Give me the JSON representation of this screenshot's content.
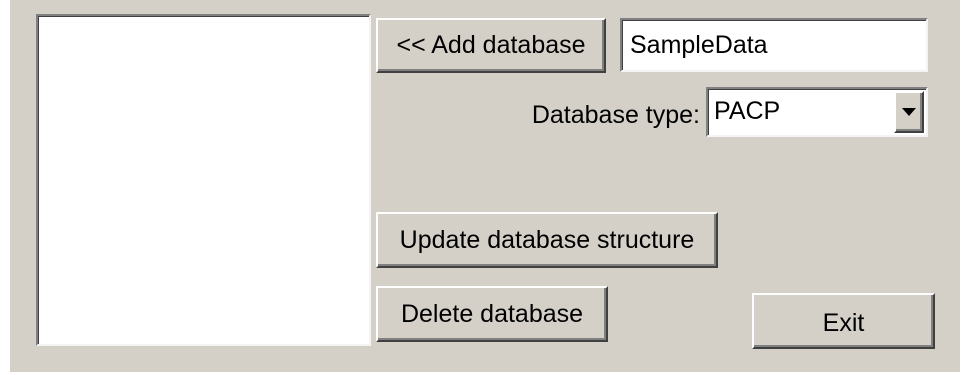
{
  "dialog": {
    "add_button_label": "<< Add database",
    "name_field_value": "SampleData",
    "type_label": "Database type:",
    "type_selected": "PACP",
    "update_button_label": "Update database structure",
    "delete_button_label": "Delete database",
    "exit_button_label": "Exit"
  },
  "colors": {
    "face": "#d4d0c8",
    "field_background": "#ffffff"
  }
}
